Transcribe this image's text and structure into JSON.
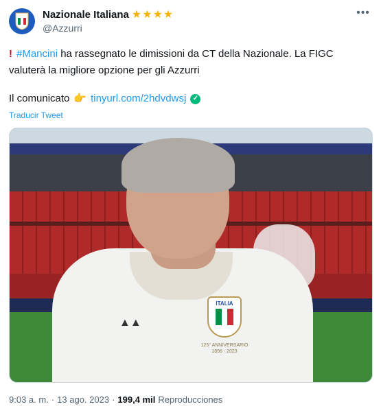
{
  "account": {
    "display_name": "Nazionale Italiana",
    "handle": "@Azzurri",
    "badge_stars": [
      "★",
      "★",
      "★",
      "★"
    ]
  },
  "tweet": {
    "hashtag": "#Mancini",
    "text_part1": " ha rassegnato le dimissioni da CT della Nazionale. La FIGC",
    "text_part2": "valuterà la migliore opzione per gli Azzurri",
    "statement_label": "Il comunicato",
    "link_text": "tinyurl.com/2hdvdwsj",
    "translate_label": "Traducir Tweet"
  },
  "media": {
    "crest_label": "ITALIA",
    "anniversary_text": "125° ANNIVERSARIO 1898 - 2023"
  },
  "footer": {
    "time": "9:03 a. m.",
    "separator1": "·",
    "date": "13 ago. 2023",
    "separator2": "·",
    "views_count": "199,4 mil",
    "views_label": "Reproducciones"
  },
  "colors": {
    "link": "#1d9bf0",
    "stars": "#f5b301",
    "verified": "#00ba7c"
  },
  "icons": {
    "exclamation": "exclamation-icon",
    "pointing_hand": "pointing-hand-icon",
    "verified": "verified-check-icon",
    "more": "more-icon"
  }
}
